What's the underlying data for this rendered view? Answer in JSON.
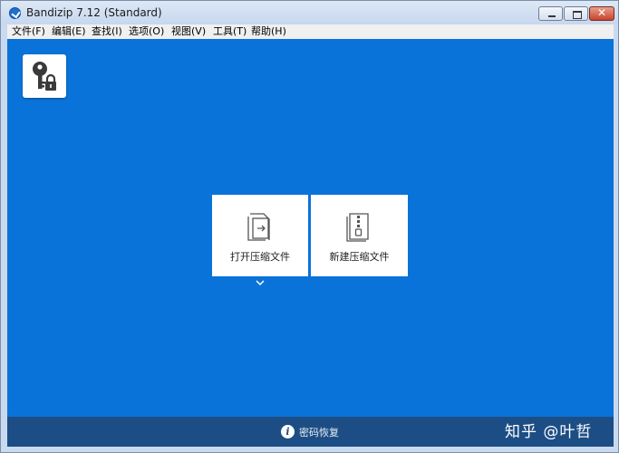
{
  "window": {
    "title": "Bandizip 7.12 (Standard)",
    "controls": {
      "minimize_icon": "minimize-icon",
      "maximize_icon": "maximize-icon",
      "close_label": "✕"
    }
  },
  "menu": {
    "items": [
      {
        "label": "文件(F)"
      },
      {
        "label": "编辑(E)"
      },
      {
        "label": "查找(I)"
      },
      {
        "label": "选项(O)"
      },
      {
        "label": "视图(V)"
      },
      {
        "label": "工具(T)"
      },
      {
        "label": "帮助(H)"
      }
    ]
  },
  "main": {
    "background_color": "#0a73d9",
    "password_tile_icon": "key-lock-icon",
    "cards": [
      {
        "label": "打开压缩文件",
        "icon": "open-archive-icon"
      },
      {
        "label": "新建压缩文件",
        "icon": "new-archive-icon"
      }
    ],
    "expand_icon": "chevron-down-icon"
  },
  "footer": {
    "icon_glyph": "i",
    "label": "密码恢复",
    "background_color": "#1c4e85"
  },
  "watermark": {
    "text": "知乎 @叶哲"
  }
}
